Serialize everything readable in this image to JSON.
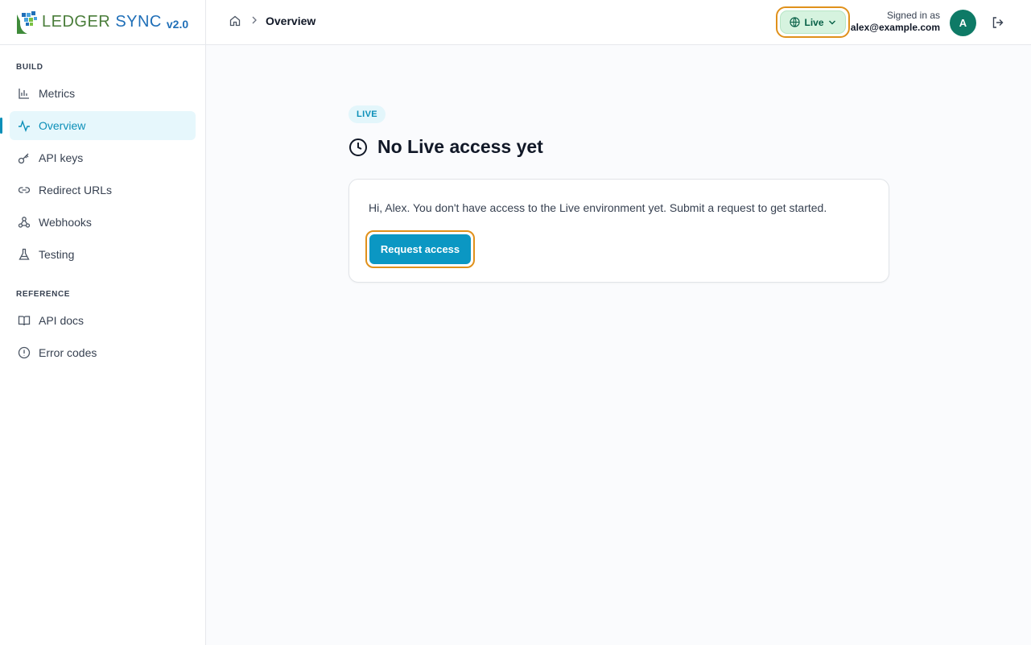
{
  "brand": {
    "name_part1": "LEDGER",
    "name_part2": "SYNC",
    "version": "v2.0"
  },
  "sidebar": {
    "sections": [
      {
        "label": "BUILD",
        "items": [
          {
            "label": "Metrics",
            "icon": "bar-chart-icon",
            "active": false
          },
          {
            "label": "Overview",
            "icon": "activity-icon",
            "active": true
          },
          {
            "label": "API keys",
            "icon": "key-icon",
            "active": false
          },
          {
            "label": "Redirect URLs",
            "icon": "link-icon",
            "active": false
          },
          {
            "label": "Webhooks",
            "icon": "webhook-icon",
            "active": false
          },
          {
            "label": "Testing",
            "icon": "flask-icon",
            "active": false
          }
        ]
      },
      {
        "label": "REFERENCE",
        "items": [
          {
            "label": "API docs",
            "icon": "book-icon",
            "active": false
          },
          {
            "label": "Error codes",
            "icon": "alert-circle-icon",
            "active": false
          }
        ]
      }
    ]
  },
  "topbar": {
    "breadcrumb_current": "Overview",
    "env_label": "Live",
    "signed_in_label": "Signed in as",
    "email": "alex@example.com",
    "avatar_initial": "A"
  },
  "main": {
    "pill": "LIVE",
    "title": "No Live access yet",
    "message": "Hi, Alex. You don't have access to the Live environment yet. Submit a request to get started.",
    "request_button": "Request access"
  },
  "colors": {
    "accent": "#0b97c3",
    "highlight_ring": "#e0911b",
    "env_badge_bg": "#d6f3df",
    "avatar_bg": "#0e7a66"
  }
}
